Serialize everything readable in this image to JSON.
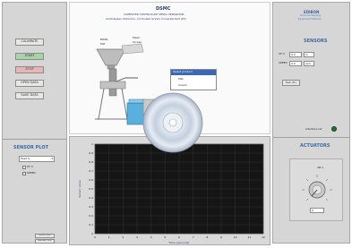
{
  "header": {
    "title": "DSMC",
    "subtitle": "COMPUTER CONTROLLED MEDIA SEPARATOR",
    "note": "Aristotelean Didactics, Controlled Grinds Computerized (PC)"
  },
  "left_buttons": [
    "CALIBRATE",
    "START",
    "STOP",
    "OPEN DATA",
    "SAVE DATA"
  ],
  "sensor_plot": {
    "title": "SENSOR PLOT",
    "select_value": "Feed S",
    "checkbox1": "SF-3",
    "checkbox2": "SPEED"
  },
  "bottom_buttons": [
    "Zoom Plot",
    "Refresh Plot"
  ],
  "diagram": {
    "hopper_label": "BOWL",
    "hopper_sub": "FeE",
    "mesh_label": "Mesh",
    "mesh_sub": "Screen",
    "dropdown_options": [
      "Select product",
      "Milk",
      "Cream"
    ]
  },
  "right_panel": {
    "brand": "EDIBON",
    "brand_sub1": "Technical Teaching",
    "brand_sub2": "Equipment Software",
    "sensors_title": "SENSORS",
    "sensor1_label": "SF-3",
    "sensor1_value": "0.0",
    "sensor1_unit": "%",
    "sensor2_label": "SPEED",
    "sensor2_value": "0.0",
    "sensor2_unit": "rpm",
    "config_button": "Test (H.)",
    "interface_label": "Interface ref",
    "actuators_title": "ACTUATORS",
    "knob_label": "AB-1",
    "knob_value": "0"
  },
  "chart_data": {
    "type": "line",
    "x_ticks": [
      "0",
      "1",
      "2",
      "3",
      "4",
      "5",
      "6",
      "7",
      "8",
      "9",
      "10",
      "11",
      "12"
    ],
    "y_ticks": [
      "1",
      "0.9",
      "0.8",
      "0.7",
      "0.6",
      "0.5",
      "0.4",
      "0.3",
      "0.2",
      "0.1",
      "0"
    ],
    "ylabel": "Sensor value",
    "xlabel": "Time (seconds)",
    "grid": true,
    "series": []
  },
  "overlay": {
    "disc_icon": "cd-disc-icon"
  },
  "colors": {
    "accent": "#3b6aa6",
    "green_button": "#9ccf9c",
    "red_button": "#e38a8a",
    "chart_bg": "#151515"
  }
}
